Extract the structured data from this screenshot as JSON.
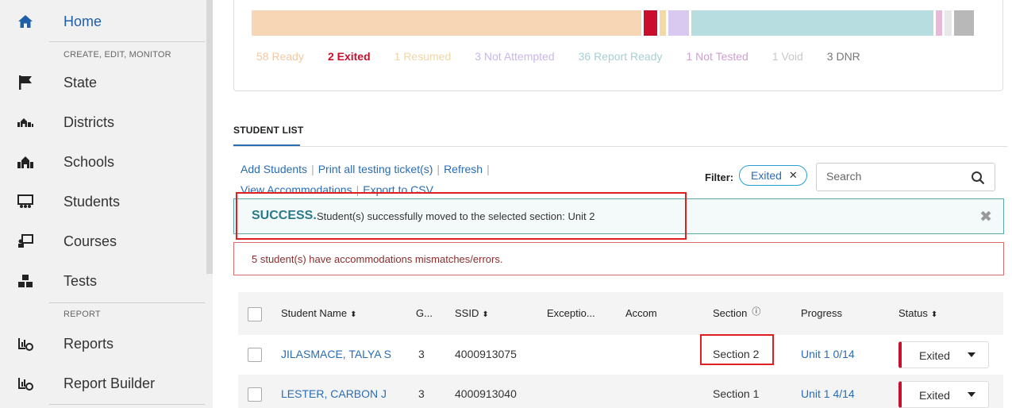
{
  "sidebar": {
    "items": [
      {
        "label": "Home",
        "icon": "home-icon"
      },
      {
        "label": "State",
        "icon": "flag-icon"
      },
      {
        "label": "Districts",
        "icon": "districts-icon"
      },
      {
        "label": "Schools",
        "icon": "schools-icon"
      },
      {
        "label": "Students",
        "icon": "students-icon"
      },
      {
        "label": "Courses",
        "icon": "courses-icon"
      },
      {
        "label": "Tests",
        "icon": "tests-icon"
      },
      {
        "label": "Reports",
        "icon": "reports-icon"
      },
      {
        "label": "Report Builder",
        "icon": "report-builder-icon"
      }
    ],
    "section_create": "CREATE, EDIT, MONITOR",
    "section_report": "REPORT"
  },
  "summary": {
    "segments": [
      {
        "label": "58 Ready",
        "value": 58,
        "color": "#f7d6b6"
      },
      {
        "label": "2 Exited",
        "value": 2,
        "color": "#c8102e"
      },
      {
        "label": "1 Resumed",
        "value": 1,
        "color": "#f4d9a8"
      },
      {
        "label": "3 Not Attempted",
        "value": 3,
        "color": "#d9c8f0"
      },
      {
        "label": "36 Report Ready",
        "value": 36,
        "color": "#b7dde0"
      },
      {
        "label": "1 Not Tested",
        "value": 1,
        "color": "#e8b8d8"
      },
      {
        "label": "1 Void",
        "value": 1,
        "color": "#e8e8e8"
      },
      {
        "label": "3 DNR",
        "value": 3,
        "color": "#b8b8b8"
      }
    ],
    "legend_colors": [
      "#f2c9a3",
      "#c8102e",
      "#f0d6a8",
      "#c9b7ea",
      "#a6cfd3",
      "#cf9fcf",
      "#c8c8c8",
      "#777777"
    ]
  },
  "student_list": {
    "tab_label": "STUDENT LIST",
    "actions": [
      "Add Students",
      "Print all testing ticket(s)",
      "Refresh",
      "View Accommodations",
      "Export to CSV"
    ],
    "filter_label": "Filter:",
    "filter_chip": "Exited",
    "search_placeholder": "Search"
  },
  "alerts": {
    "success_title": "SUCCESS.",
    "success_message": "Student(s) successfully moved to the selected section: Unit 2",
    "error_message": "5 student(s) have accommodations mismatches/errors."
  },
  "table": {
    "headers": {
      "name": "Student Name",
      "grade": "G...",
      "ssid": "SSID",
      "exceptions": "Exceptio...",
      "accom": "Accom",
      "section": "Section",
      "progress": "Progress",
      "status": "Status"
    },
    "rows": [
      {
        "name": "JILASMACE, TALYA S",
        "grade": "3",
        "ssid": "4000913075",
        "section": "Section 2",
        "progress": "Unit 1 0/14",
        "status": "Exited"
      },
      {
        "name": "LESTER, CARBON J",
        "grade": "3",
        "ssid": "4000913040",
        "section": "Section 1",
        "progress": "Unit 1 4/14",
        "status": "Exited"
      }
    ]
  }
}
